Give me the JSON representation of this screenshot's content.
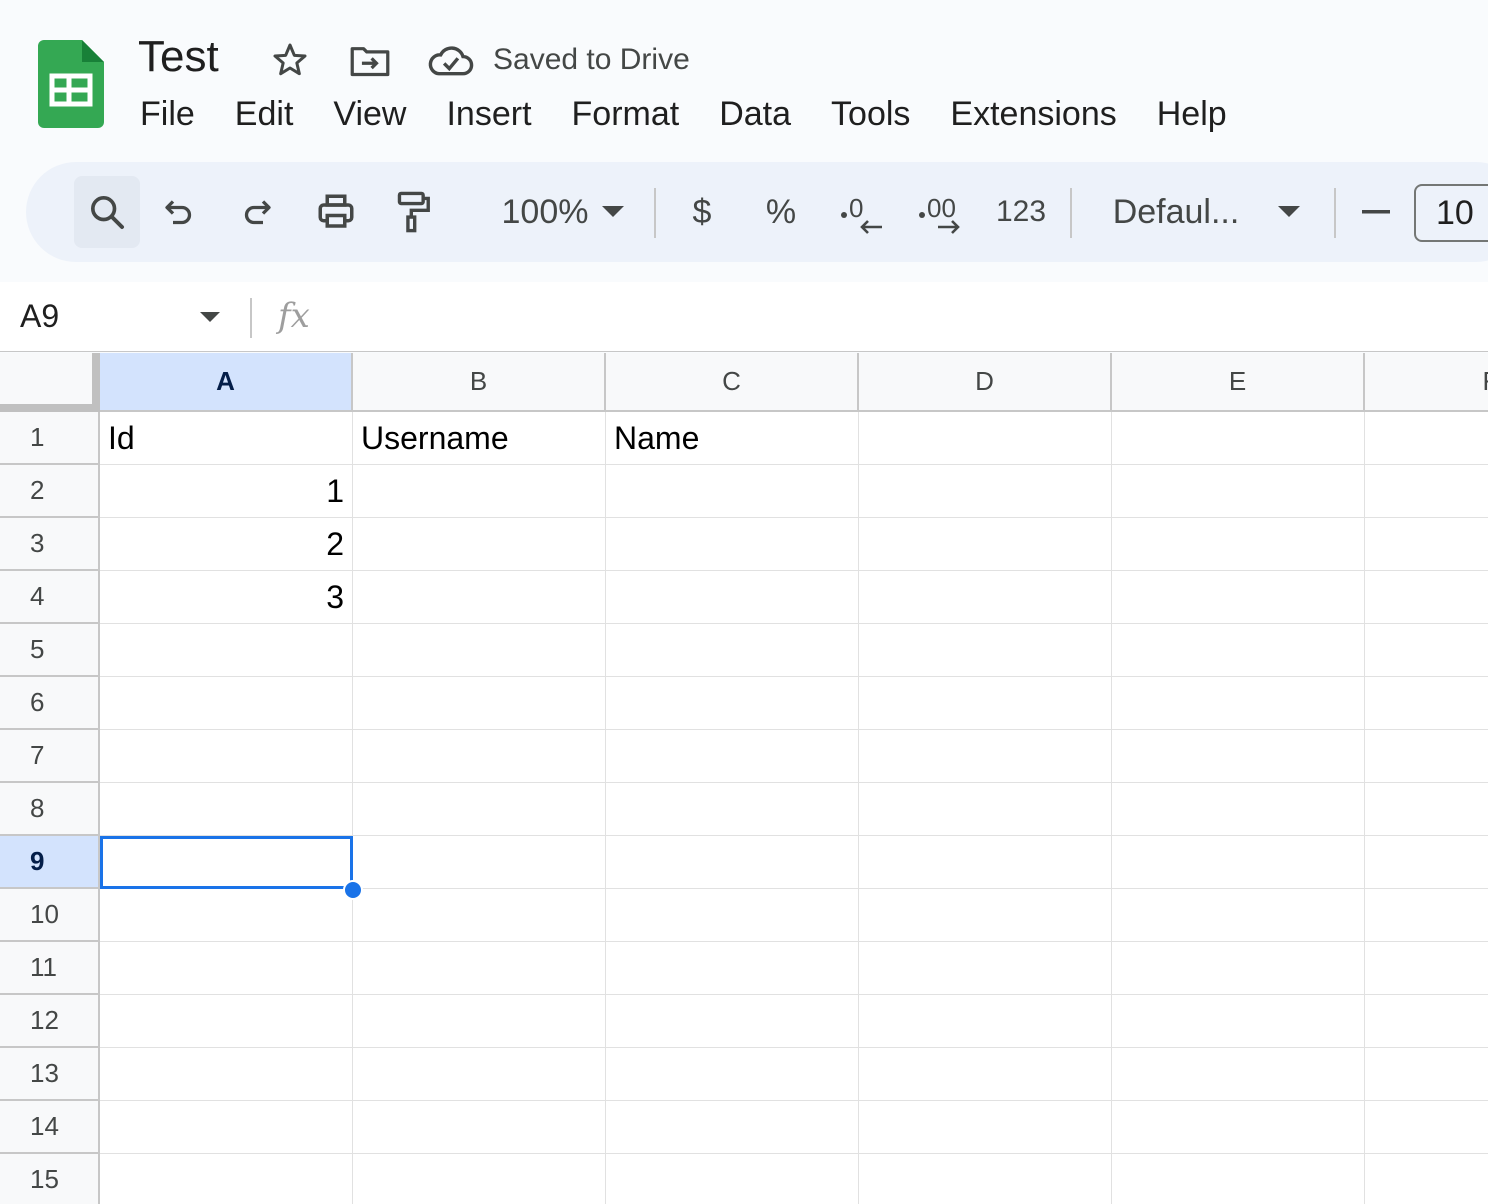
{
  "document": {
    "title": "Test",
    "save_status": "Saved to Drive"
  },
  "menu": [
    "File",
    "Edit",
    "View",
    "Insert",
    "Format",
    "Data",
    "Tools",
    "Extensions",
    "Help"
  ],
  "toolbar": {
    "zoom": "100%",
    "currency": "$",
    "percent": "%",
    "more_formats": "123",
    "font": "Defaul...",
    "font_size": "10"
  },
  "formula_bar": {
    "name_box": "A9",
    "value": ""
  },
  "sheet": {
    "columns": [
      "A",
      "B",
      "C",
      "D",
      "E",
      "F"
    ],
    "rows": [
      "1",
      "2",
      "3",
      "4",
      "5",
      "6",
      "7",
      "8",
      "9",
      "10",
      "11",
      "12",
      "13",
      "14",
      "15"
    ],
    "cells": {
      "A1": "Id",
      "B1": "Username",
      "C1": "Name",
      "A2": "1",
      "A3": "2",
      "A4": "3"
    },
    "selected_cell": "A9",
    "selected_column": "A",
    "selected_row": "9"
  },
  "colors": {
    "selection": "#1a73e8",
    "header_selected": "#d3e3fd",
    "toolbar_bg": "#edf2fa",
    "logo": "#34a853"
  }
}
